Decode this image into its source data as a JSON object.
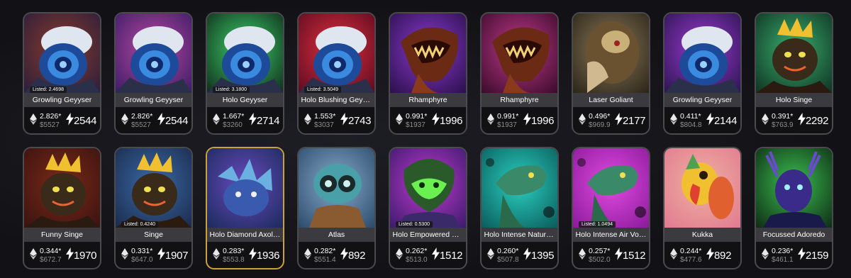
{
  "cards": [
    {
      "name": "Growling Geyyser",
      "listed": "Listed: 2.4698",
      "eth": "2.826*",
      "usd": "$5527",
      "power": "2544",
      "art": "geyser",
      "bg": [
        "#2a1d3c",
        "#8a3b2a"
      ]
    },
    {
      "name": "Growling Geyyser",
      "listed": "",
      "eth": "2.826*",
      "usd": "$5527",
      "power": "2544",
      "art": "geyser",
      "bg": [
        "#3a1b66",
        "#b84aa0"
      ]
    },
    {
      "name": "Holo Geyyser",
      "listed": "Listed: 3.1800",
      "eth": "1.667*",
      "usd": "$3260",
      "power": "2714",
      "art": "geyser",
      "bg": [
        "#0f2a1a",
        "#3cd06a"
      ]
    },
    {
      "name": "Holo Blushing Geyyser",
      "listed": "Listed: 3.5049",
      "eth": "1.553*",
      "usd": "$3037",
      "power": "2743",
      "art": "geyser",
      "bg": [
        "#5a0a20",
        "#e0303e"
      ]
    },
    {
      "name": "Rhamphyre",
      "listed": "",
      "eth": "0.991*",
      "usd": "$1937",
      "power": "1996",
      "art": "dragon",
      "bg": [
        "#2a0f4a",
        "#8a3ad0"
      ]
    },
    {
      "name": "Rhamphyre",
      "listed": "",
      "eth": "0.991*",
      "usd": "$1937",
      "power": "1996",
      "art": "dragon",
      "bg": [
        "#3a0a2a",
        "#c03a8a"
      ]
    },
    {
      "name": "Laser Goliant",
      "listed": "",
      "eth": "0.496*",
      "usd": "$969.9",
      "power": "2177",
      "art": "goliant",
      "bg": [
        "#2a2318",
        "#8a7a58"
      ]
    },
    {
      "name": "Growling Geyyser",
      "listed": "",
      "eth": "0.411*",
      "usd": "$804.8",
      "power": "2144",
      "art": "geyser",
      "bg": [
        "#2a1450",
        "#9a3ad0"
      ]
    },
    {
      "name": "Holo Singe",
      "listed": "",
      "eth": "0.391*",
      "usd": "$763.9",
      "power": "2292",
      "art": "singe",
      "bg": [
        "#0e3020",
        "#3ab070"
      ]
    },
    {
      "name": "Funny Singe",
      "listed": "",
      "eth": "0.344*",
      "usd": "$672.7",
      "power": "1970",
      "art": "singe",
      "bg": [
        "#3a1210",
        "#7a2a18"
      ]
    },
    {
      "name": "Singe",
      "listed": "Listed: 0.4240",
      "eth": "0.331*",
      "usd": "$647.0",
      "power": "1907",
      "art": "singe",
      "bg": [
        "#1a2a4a",
        "#3a6aa8"
      ]
    },
    {
      "name": "Holo Diamond Axolotl",
      "listed": "",
      "eth": "0.283*",
      "usd": "$553.8",
      "power": "1936",
      "art": "axo",
      "bg": [
        "#1a2a5a",
        "#6a4ac0"
      ],
      "gold": true
    },
    {
      "name": "Atlas",
      "listed": "",
      "eth": "0.282*",
      "usd": "$551.4",
      "power": "892",
      "art": "atlas",
      "bg": [
        "#2a4a6a",
        "#88aacc"
      ]
    },
    {
      "name": "Holo Empowered Wanderer",
      "listed": "Listed: 0.5300",
      "eth": "0.262*",
      "usd": "$513.0",
      "power": "1512",
      "art": "wanderer",
      "bg": [
        "#3a1a6a",
        "#c03ad0"
      ]
    },
    {
      "name": "Holo Intense Nature Lizard",
      "listed": "",
      "eth": "0.260*",
      "usd": "$507.8",
      "power": "1395",
      "art": "lizard",
      "bg": [
        "#0a5a5a",
        "#2ad0c0"
      ]
    },
    {
      "name": "Holo Intense Air Vortex",
      "listed": "Listed: 1.0494",
      "eth": "0.257*",
      "usd": "$502.0",
      "power": "1512",
      "art": "lizard",
      "bg": [
        "#8a1a9a",
        "#e04ae0"
      ]
    },
    {
      "name": "Kukka",
      "listed": "",
      "eth": "0.244*",
      "usd": "$477.6",
      "power": "892",
      "art": "bird",
      "bg": [
        "#e07a90",
        "#f0b0a0"
      ]
    },
    {
      "name": "Focussed Adoredo",
      "listed": "",
      "eth": "0.236*",
      "usd": "$461.1",
      "power": "2159",
      "art": "deer",
      "bg": [
        "#0e2a14",
        "#3ac050"
      ]
    }
  ]
}
